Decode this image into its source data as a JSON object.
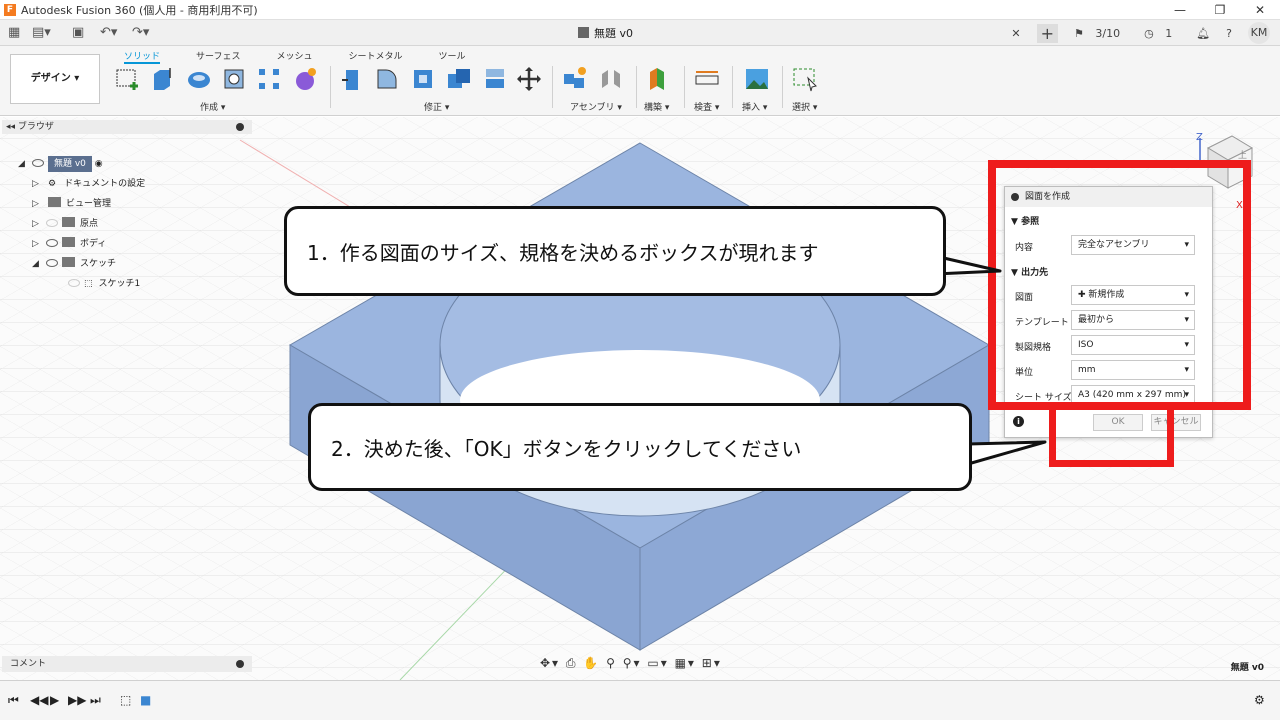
{
  "window": {
    "title": "Autodesk Fusion 360 (個人用 - 商用利用不可)",
    "app_icon": "F"
  },
  "topbar": {
    "doc_tab": "無題 v0",
    "jobs": "3/10",
    "notifications": "1",
    "user_initials": "KM"
  },
  "ribbon": {
    "workspace": "デザイン",
    "tabs": [
      "ソリッド",
      "サーフェス",
      "メッシュ",
      "シートメタル",
      "ツール"
    ],
    "groups": [
      "作成",
      "修正",
      "アセンブリ",
      "構築",
      "検査",
      "挿入",
      "選択"
    ]
  },
  "browser": {
    "title": "ブラウザ",
    "root": "無題 v0",
    "items": [
      "ドキュメントの設定",
      "ビュー管理",
      "原点",
      "ボディ",
      "スケッチ"
    ],
    "sketch_child": "スケッチ1"
  },
  "comment_panel": "コメント",
  "doc_name_bottom": "無題 v0",
  "dialog": {
    "title": "図面を作成",
    "section_ref": "参照",
    "content_label": "内容",
    "content_value": "完全なアセンブリ",
    "section_output": "出力先",
    "drawing_label": "図面",
    "drawing_value": "新規作成",
    "template_label": "テンプレート",
    "template_value": "最初から",
    "standard_label": "製図規格",
    "standard_value": "ISO",
    "units_label": "単位",
    "units_value": "mm",
    "sheet_label": "シート サイズ",
    "sheet_value": "A3 (420 mm x 297 mm)",
    "ok": "OK",
    "cancel": "キャンセル"
  },
  "callouts": {
    "one": "1．作る図面のサイズ、規格を決めるボックスが現れます",
    "two": "2．決めた後、「OK」ボタンをクリックしてください"
  },
  "viewcube": {
    "axis_z": "Z",
    "axis_x": "X",
    "face": "上"
  },
  "colors": {
    "accent": "#0696d7",
    "highlight": "#ee1c1c",
    "model": "#9bb5df"
  }
}
